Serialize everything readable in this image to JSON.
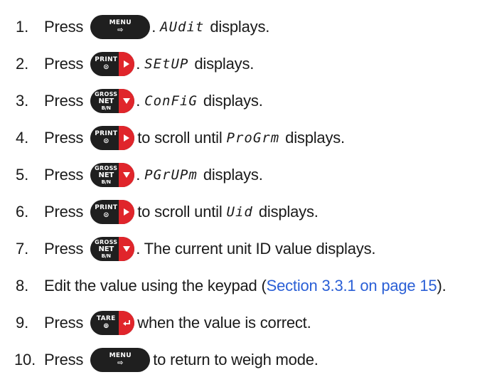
{
  "steps": [
    {
      "num": "1.",
      "press": "Press",
      "key": "MENU",
      "key_sub": "⇨",
      "seg": "AUdit",
      "after": "displays."
    },
    {
      "num": "2.",
      "press": "Press",
      "key": "PRINT",
      "key_sub": "⊙",
      "seg": "SEtUP",
      "after": "displays."
    },
    {
      "num": "3.",
      "press": "Press",
      "key": "GROSS",
      "key_sub": "NET",
      "key_sub2": "B/N",
      "seg": "ConFiG",
      "after": "displays."
    },
    {
      "num": "4.",
      "press": "Press",
      "key": "PRINT",
      "key_sub": "⊙",
      "text1": "to scroll until",
      "seg": "ProGrm",
      "after": "displays."
    },
    {
      "num": "5.",
      "press": "Press",
      "key": "GROSS",
      "key_sub": "NET",
      "key_sub2": "B/N",
      "seg": "PGrUPm",
      "after": "displays."
    },
    {
      "num": "6.",
      "press": "Press",
      "key": "PRINT",
      "key_sub": "⊙",
      "text1": "to scroll until",
      "seg": "Uid",
      "after": "displays."
    },
    {
      "num": "7.",
      "press": "Press",
      "key": "GROSS",
      "key_sub": "NET",
      "key_sub2": "B/N",
      "after": ". The current unit ID value displays."
    },
    {
      "num": "8.",
      "text1": "Edit the value using the keypad (",
      "link": "Section 3.3.1 on page 15",
      "after": ")."
    },
    {
      "num": "9.",
      "press": "Press",
      "key": "TARE",
      "key_sub": "⊕",
      "after": "when the value is correct."
    },
    {
      "num": "10.",
      "press": "Press",
      "key": "MENU",
      "key_sub": "⇨",
      "after": "to return to weigh mode."
    }
  ],
  "colors": {
    "key": "#1f1f1f",
    "key_accent": "#e0252b",
    "link": "#2a5fd6"
  },
  "icons": {
    "arrow_right": "▶",
    "arrow_down": "▼",
    "enter": "↵"
  }
}
